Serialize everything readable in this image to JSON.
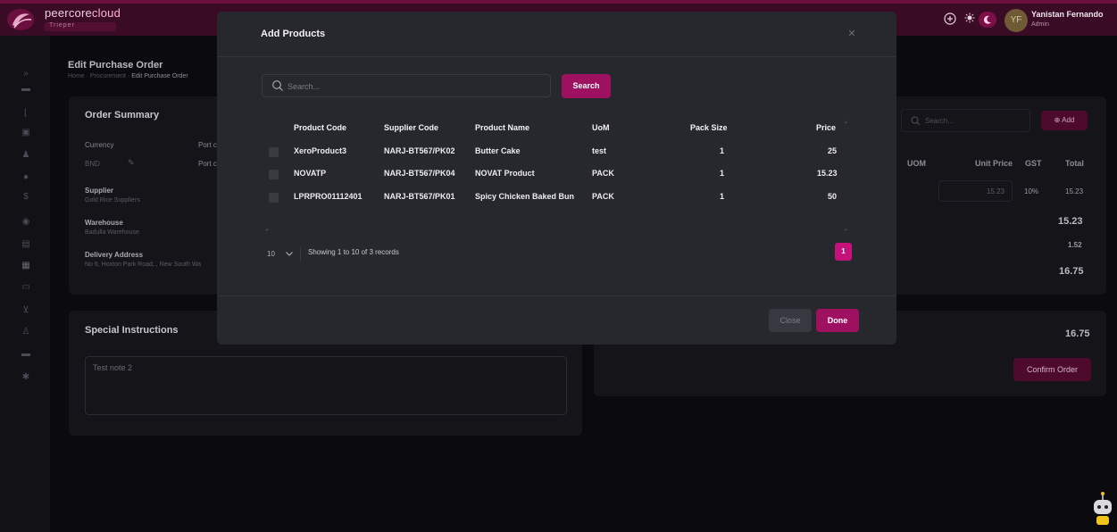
{
  "app": {
    "brand_main": "peercore",
    "brand_accent": "cloud",
    "brand_sub": "Trieper"
  },
  "user": {
    "initials": "YF",
    "name": "Yanistan Fernando",
    "role": "Admin"
  },
  "sidebar": {
    "icons": [
      "chevron-right-icon",
      "card-icon",
      "chart-icon",
      "box-icon",
      "person-icon",
      "coin-icon",
      "dollar-icon",
      "circle-icon",
      "file-icon",
      "store-icon",
      "truck-icon",
      "cart-icon",
      "user-icon",
      "wallet-icon",
      "settings-icon"
    ]
  },
  "page": {
    "title": "Edit Purchase Order",
    "breadcrumb_home": "Home",
    "breadcrumb_section": "Procurement",
    "breadcrumb_current": "Edit Purchase Order"
  },
  "order_summary": {
    "title": "Order Summary",
    "currency_label": "Currency",
    "currency_value": "BND",
    "port_label": "Port c",
    "port_value": "Port c",
    "supplier_label": "Supplier",
    "supplier_value": "Gold Rice Suppliers",
    "warehouse_label": "Warehouse",
    "warehouse_value": "Badulla Warehouse",
    "delivery_label": "Delivery Address",
    "delivery_value": "No 6, Hoxton Park Road, , New South Wa"
  },
  "special_instructions": {
    "title": "Special Instructions",
    "note": "Test note 2"
  },
  "product_panel": {
    "search_placeholder": "Search...",
    "add_label": "Add",
    "col_uom": "UOM",
    "col_unit_price": "Unit Price",
    "col_gst": "GST",
    "col_total": "Total",
    "row_unit_price": "15.23",
    "row_gst": "10%",
    "row_total": "15.23",
    "subtotal": "15.23",
    "tax": "1.52",
    "grand_total": "16.75",
    "footer_total": "16.75",
    "confirm_label": "Confirm Order"
  },
  "modal": {
    "title": "Add Products",
    "search_placeholder": "Search...",
    "search_button": "Search",
    "columns": [
      "Product Code",
      "Supplier Code",
      "Product Name",
      "UoM",
      "Pack Size",
      "Price"
    ],
    "rows": [
      {
        "product_code": "XeroProduct3",
        "supplier_code": "NARJ-BT567/PK02",
        "product_name": "Butter Cake",
        "uom": "test",
        "pack_size": "1",
        "price": "25"
      },
      {
        "product_code": "NOVATP",
        "supplier_code": "NARJ-BT567/PK04",
        "product_name": "NOVAT Product",
        "uom": "PACK",
        "pack_size": "1",
        "price": "15.23"
      },
      {
        "product_code": "LPRPRO01112401",
        "supplier_code": "NARJ-BT567/PK01",
        "product_name": "Spicy Chicken Baked Bun",
        "uom": "PACK",
        "pack_size": "1",
        "price": "50"
      }
    ],
    "page_size": "10",
    "showing_text": "Showing 1 to 10 of 3 records",
    "current_page": "1",
    "close_label": "Close",
    "done_label": "Done"
  },
  "colors": {
    "accent": "#9e1060",
    "accent_bright": "#c4127a",
    "topbar": "#3a0b24",
    "modal_bg": "#27272e",
    "page_bg": "#0b0b0f"
  }
}
